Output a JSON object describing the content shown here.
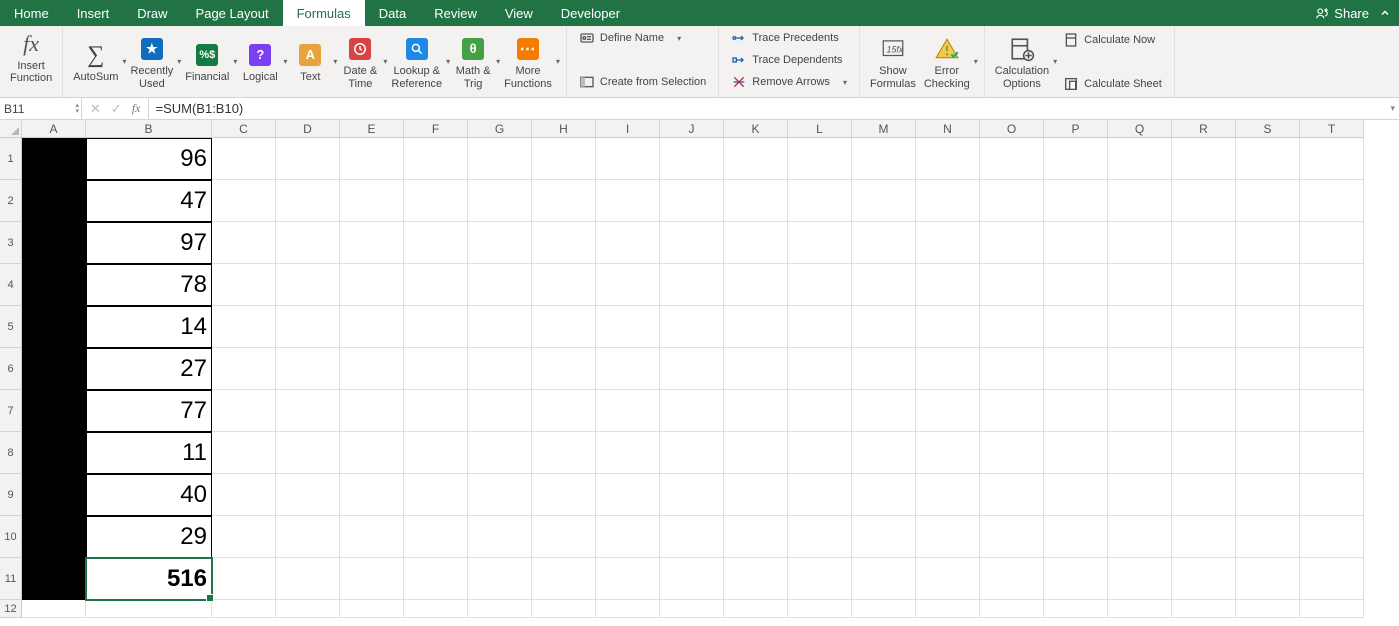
{
  "tabs": {
    "items": [
      "Home",
      "Insert",
      "Draw",
      "Page Layout",
      "Formulas",
      "Data",
      "Review",
      "View",
      "Developer"
    ],
    "active": "Formulas",
    "share": "Share"
  },
  "ribbon": {
    "insert_function": "Insert\nFunction",
    "autosum": "AutoSum",
    "recently_used": "Recently\nUsed",
    "financial": "Financial",
    "logical": "Logical",
    "text": "Text",
    "date_time": "Date &\nTime",
    "lookup_ref": "Lookup &\nReference",
    "math_trig": "Math &\nTrig",
    "more_functions": "More\nFunctions",
    "define_name": "Define Name",
    "create_from_selection": "Create from Selection",
    "trace_precedents": "Trace Precedents",
    "trace_dependents": "Trace Dependents",
    "remove_arrows": "Remove Arrows",
    "show_formulas": "Show\nFormulas",
    "error_checking": "Error\nChecking",
    "calc_options": "Calculation\nOptions",
    "calc_now": "Calculate Now",
    "calc_sheet": "Calculate Sheet"
  },
  "formula_bar": {
    "name_box": "B11",
    "formula": "=SUM(B1:B10)"
  },
  "columns": [
    "A",
    "B",
    "C",
    "D",
    "E",
    "F",
    "G",
    "H",
    "I",
    "J",
    "K",
    "L",
    "M",
    "N",
    "O",
    "P",
    "Q",
    "R",
    "S",
    "T"
  ],
  "data": {
    "B": [
      96,
      47,
      97,
      78,
      14,
      27,
      77,
      11,
      40,
      29,
      516
    ]
  },
  "selected_cell": "B11",
  "row_count_visible": 12
}
